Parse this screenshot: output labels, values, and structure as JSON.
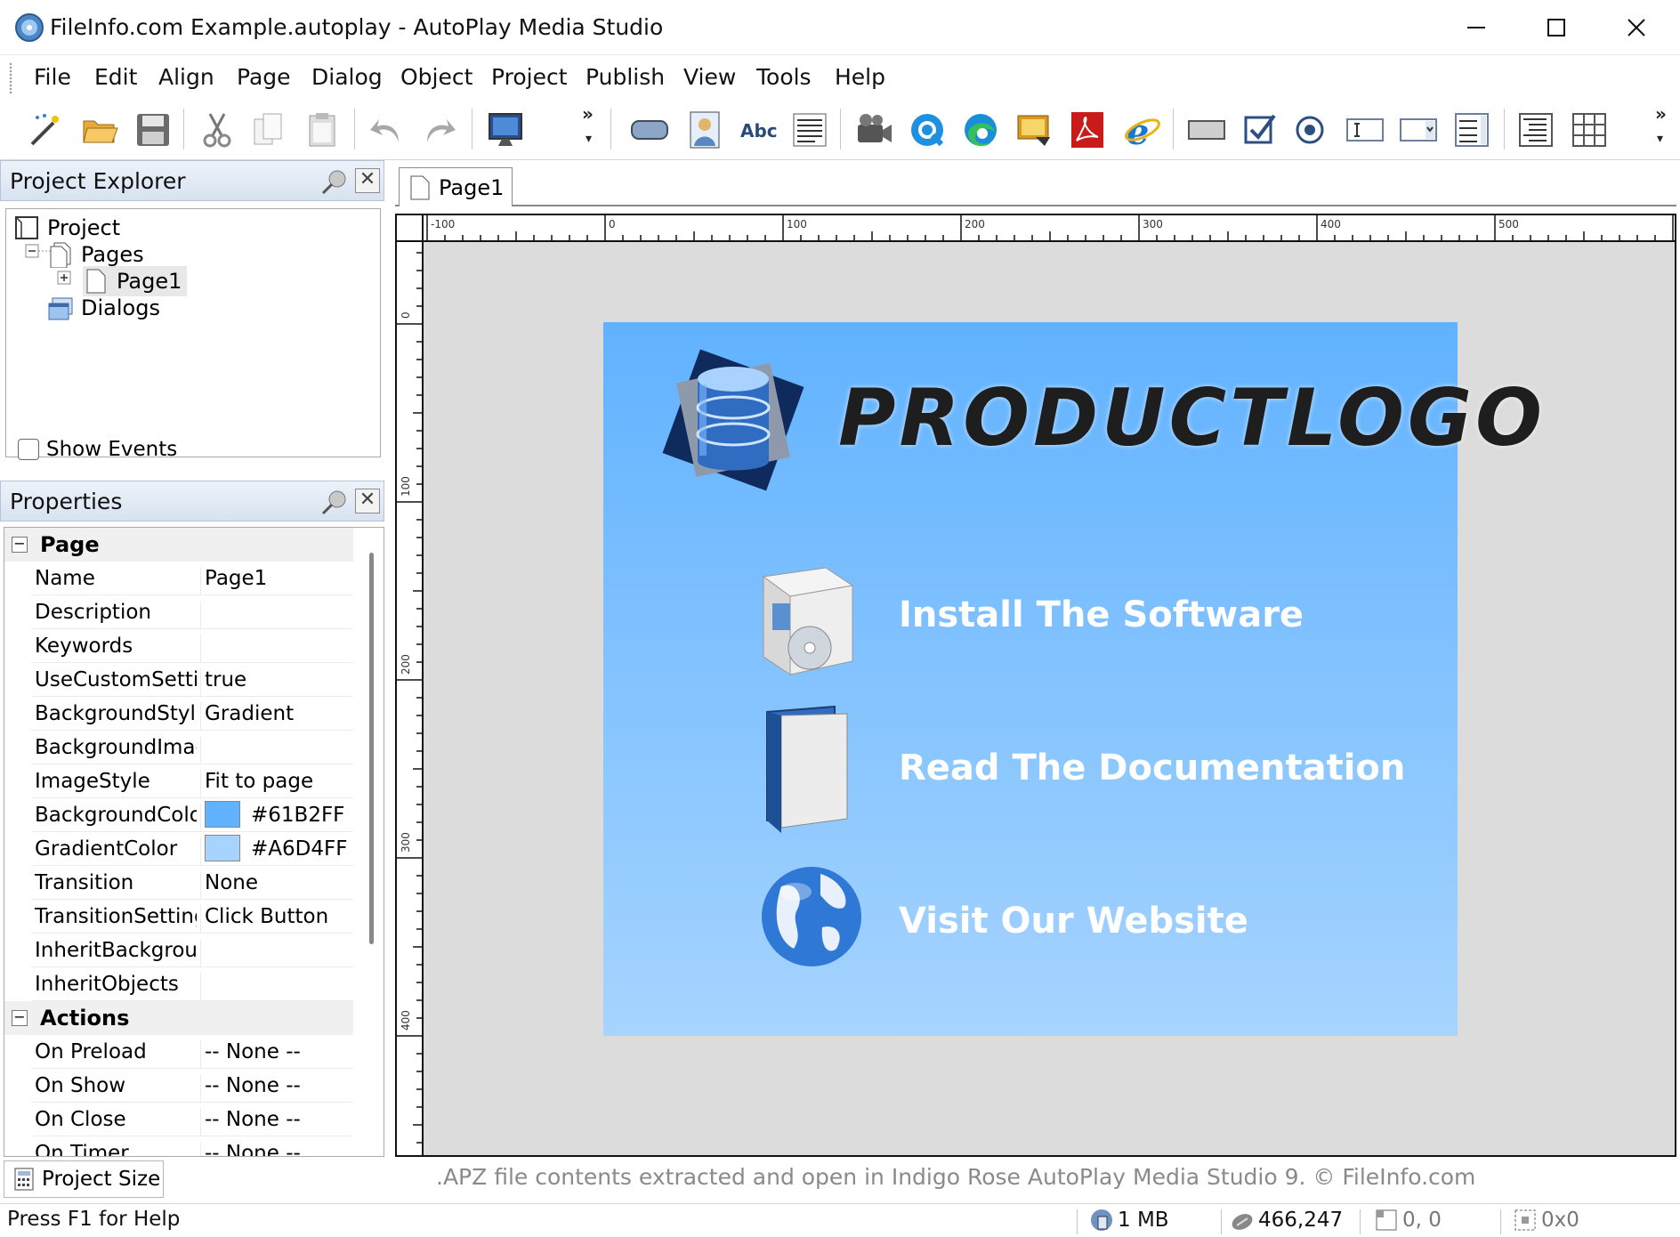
{
  "window": {
    "title": "FileInfo.com Example.autoplay - AutoPlay Media Studio"
  },
  "menu": [
    "File",
    "Edit",
    "Align",
    "Page",
    "Dialog",
    "Object",
    "Project",
    "Publish",
    "View",
    "Tools",
    "Help"
  ],
  "project_explorer": {
    "title": "Project Explorer",
    "tree": {
      "root": "Project",
      "pages": "Pages",
      "page1": "Page1",
      "dialogs": "Dialogs"
    },
    "show_events": "Show Events"
  },
  "properties": {
    "title": "Properties",
    "groups": {
      "page": "Page",
      "actions": "Actions"
    },
    "rows": [
      {
        "name": "Name",
        "value": "Page1"
      },
      {
        "name": "Description",
        "value": ""
      },
      {
        "name": "Keywords",
        "value": ""
      },
      {
        "name": "UseCustomSettir",
        "value": "true"
      },
      {
        "name": "BackgroundStyle",
        "value": "Gradient"
      },
      {
        "name": "BackgroundImag",
        "value": ""
      },
      {
        "name": "ImageStyle",
        "value": "Fit to page"
      },
      {
        "name": "BackgroundColo",
        "value": "#61B2FF",
        "color": "#61B2FF"
      },
      {
        "name": "GradientColor",
        "value": "#A6D4FF",
        "color": "#A6D4FF"
      },
      {
        "name": "Transition",
        "value": "None"
      },
      {
        "name": "TransitionSetting",
        "value": "Click Button"
      },
      {
        "name": "InheritBackgrour",
        "value": ""
      },
      {
        "name": "InheritObjects",
        "value": ""
      }
    ],
    "action_rows": [
      {
        "name": "On Preload",
        "value": "-- None --"
      },
      {
        "name": "On Show",
        "value": "-- None --"
      },
      {
        "name": "On Close",
        "value": "-- None --"
      },
      {
        "name": "On Timer",
        "value": "-- None --"
      }
    ]
  },
  "project_size": "Project Size",
  "editor": {
    "tab": "Page1",
    "hruler_labels": [
      "-100",
      "0",
      "100",
      "200",
      "300",
      "400",
      "500"
    ],
    "vruler_labels": [
      "0",
      "100",
      "200",
      "300",
      "400"
    ],
    "page": {
      "logo": "PRODUCTLOGO",
      "links": [
        "Install The Software",
        "Read The Documentation",
        "Visit Our Website"
      ],
      "background_color": "#61B2FF",
      "gradient_color": "#A6D4FF"
    }
  },
  "caption": ".APZ file contents extracted and open in Indigo Rose AutoPlay Media Studio 9. © FileInfo.com",
  "status": {
    "help": "Press F1 for Help",
    "memory": "1 MB",
    "cursor": "466,247",
    "position": "0, 0",
    "size": "0x0"
  }
}
